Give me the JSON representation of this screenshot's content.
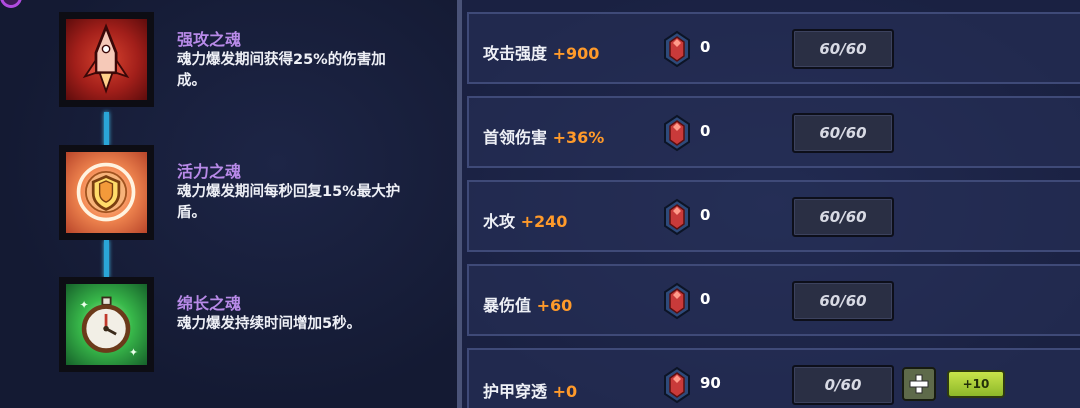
{
  "skills": [
    {
      "name": "强攻之魂",
      "desc_line1": "魂力爆发期间获得25%的伤害加",
      "desc_line2": "成。"
    },
    {
      "name": "活力之魂",
      "desc_line1": "魂力爆发期间每秒回复15%最大护",
      "desc_line2": "盾。"
    },
    {
      "name": "绵长之魂",
      "desc_line1": "魂力爆发持续时间增加5秒。",
      "desc_line2": ""
    }
  ],
  "stats": [
    {
      "name": "攻击强度",
      "bonus": "+900",
      "gems": "0",
      "level": "60/60"
    },
    {
      "name": "首领伤害",
      "bonus": "+36%",
      "gems": "0",
      "level": "60/60"
    },
    {
      "name": "水攻",
      "bonus": "+240",
      "gems": "0",
      "level": "60/60"
    },
    {
      "name": "暴伤值",
      "bonus": "+60",
      "gems": "0",
      "level": "60/60"
    },
    {
      "name": "护甲穿透",
      "bonus": "+0",
      "gems": "90",
      "level": "0/60",
      "plus10_label": "+10"
    }
  ],
  "icons": {
    "node1": "rocket-icon",
    "node2": "shield-icon",
    "node3": "stopwatch-icon",
    "gem": "gem-icon",
    "plus": "plus-icon"
  },
  "colors": {
    "bonus": "#ff9a2a",
    "skill_name": "#b88ae8",
    "connector": "#2aa6d8"
  }
}
